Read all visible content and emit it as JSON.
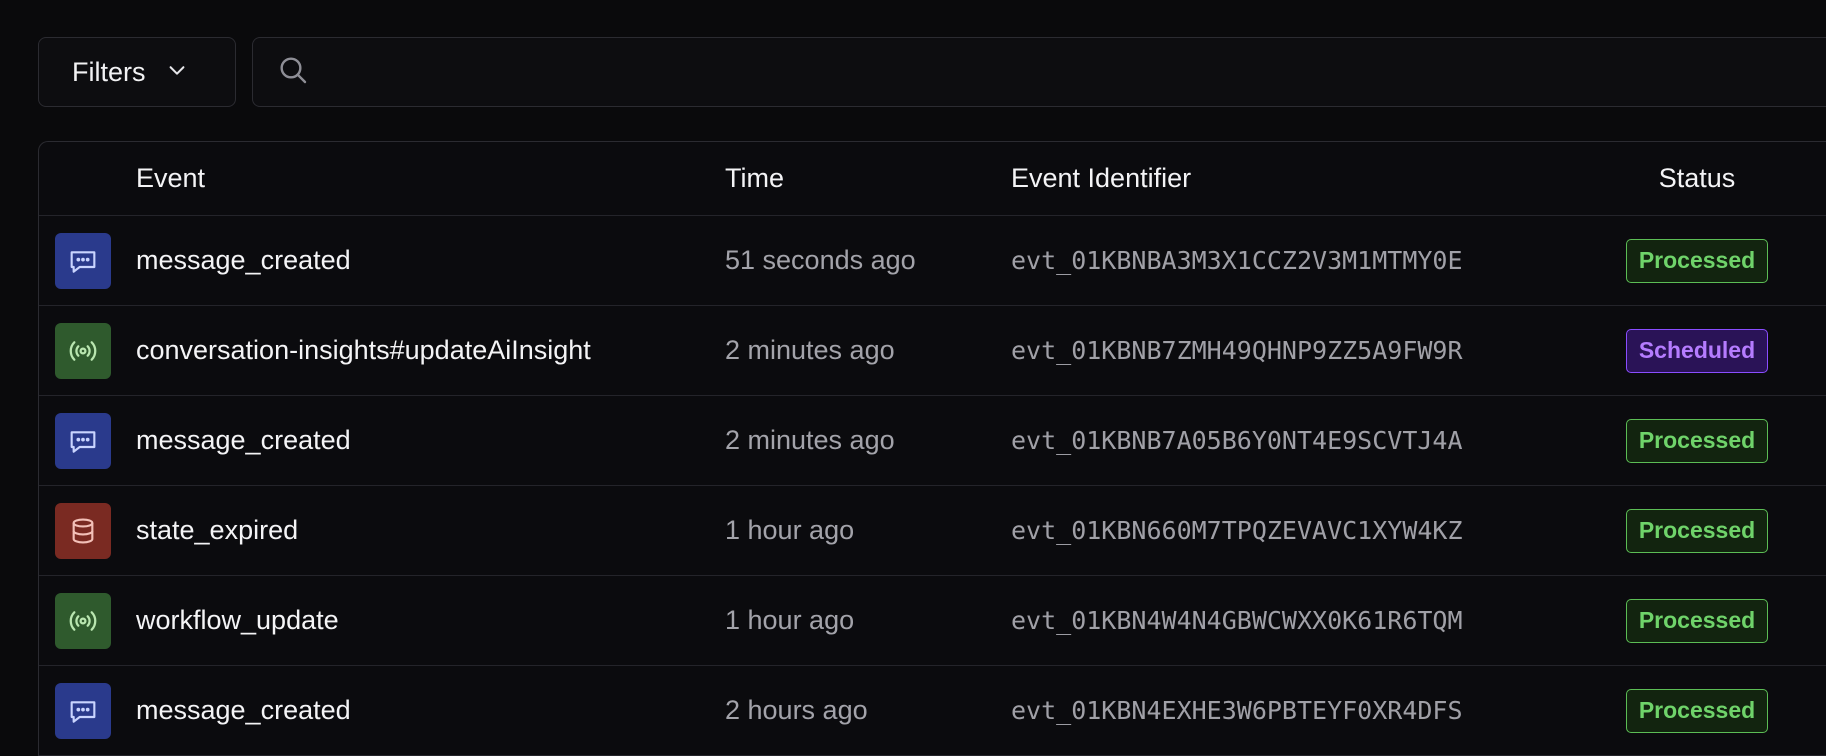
{
  "toolbar": {
    "filters_label": "Filters",
    "search_value": "",
    "search_placeholder": ""
  },
  "table": {
    "columns": {
      "event": "Event",
      "time": "Time",
      "identifier": "Event Identifier",
      "status": "Status"
    },
    "rows": [
      {
        "icon": "message-icon",
        "event": "message_created",
        "time": "51 seconds ago",
        "id": "evt_01KBNBA3M3X1CCZ2V3M1MTMY0E",
        "status": "Processed"
      },
      {
        "icon": "broadcast-icon",
        "event": "conversation-insights#updateAiInsight",
        "time": "2 minutes ago",
        "id": "evt_01KBNB7ZMH49QHNP9ZZ5A9FW9R",
        "status": "Scheduled"
      },
      {
        "icon": "message-icon",
        "event": "message_created",
        "time": "2 minutes ago",
        "id": "evt_01KBNB7A05B6Y0NT4E9SCVTJ4A",
        "status": "Processed"
      },
      {
        "icon": "database-icon",
        "event": "state_expired",
        "time": "1 hour ago",
        "id": "evt_01KBN660M7TPQZEVAVC1XYW4KZ",
        "status": "Processed"
      },
      {
        "icon": "broadcast-icon",
        "event": "workflow_update",
        "time": "1 hour ago",
        "id": "evt_01KBN4W4N4GBWCWXX0K61R6TQM",
        "status": "Processed"
      },
      {
        "icon": "message-icon",
        "event": "message_created",
        "time": "2 hours ago",
        "id": "evt_01KBN4EXHE3W6PBTEYF0XR4DFS",
        "status": "Processed"
      }
    ]
  },
  "colors": {
    "message_icon_bg": "#2a3a8c",
    "message_icon_fg": "#c9d4ff",
    "broadcast_icon_bg": "#2f5a2d",
    "broadcast_icon_fg": "#b9e6b0",
    "database_icon_bg": "#7a2a22",
    "database_icon_fg": "#f3c0b8",
    "processed_fg": "#6fd36a",
    "processed_bg": "#12240f",
    "processed_border": "#5cbd55",
    "scheduled_fg": "#b57cff",
    "scheduled_bg": "#2a1357",
    "scheduled_border": "#8a4dff"
  }
}
